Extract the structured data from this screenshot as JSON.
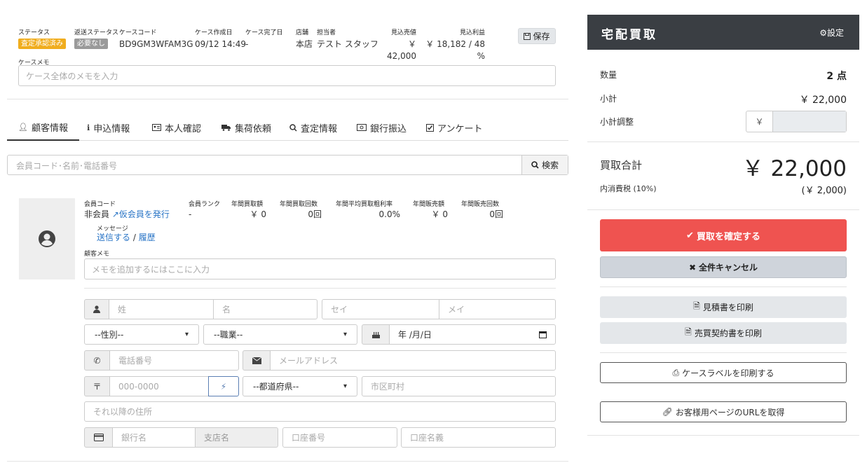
{
  "header": {
    "status_label": "ステータス",
    "status_value": "査定承認済み",
    "return_status_label": "返送ステータス",
    "return_status_value": "必要なし",
    "case_code_label": "ケースコード",
    "case_code_value": "BD9GM3WFAM3G",
    "created_label": "ケース作成日",
    "created_value": "09/12 14:49",
    "completed_label": "ケース完了日",
    "completed_value": "-",
    "store_label": "店舗",
    "store_value": "本店",
    "staff_label": "担当者",
    "staff_value": "テスト スタッフ",
    "expected_sales_label": "見込売値",
    "expected_sales_value": "￥ 42,000",
    "expected_profit_label": "見込利益",
    "expected_profit_value": "￥ 18,182 / 48 %",
    "save_label": "保存",
    "case_memo_label": "ケースメモ",
    "case_memo_placeholder": "ケース全体のメモを入力"
  },
  "tabs": [
    {
      "label": "顧客情報",
      "icon": "user-icon"
    },
    {
      "label": "申込情報",
      "icon": "info-icon"
    },
    {
      "label": "本人確認",
      "icon": "id-card-icon"
    },
    {
      "label": "集荷依頼",
      "icon": "truck-icon"
    },
    {
      "label": "査定情報",
      "icon": "search-icon"
    },
    {
      "label": "銀行振込",
      "icon": "money-icon"
    },
    {
      "label": "アンケート",
      "icon": "check-square-icon"
    }
  ],
  "search": {
    "placeholder": "会員コード･名前･電話番号",
    "button_label": "検索"
  },
  "customer": {
    "member_code_label": "会員コード",
    "member_code_value": "非会員",
    "temp_member_link": "仮会員を発行",
    "rank_label": "会員ランク",
    "rank_value": "-",
    "annual_purchase_label": "年間買取額",
    "annual_purchase_value": "￥ 0",
    "annual_purchase_count_label": "年間買取回数",
    "annual_purchase_count_value": "0回",
    "avg_margin_label": "年間平均買取粗利率",
    "avg_margin_value": "0.0%",
    "annual_sales_label": "年間販売額",
    "annual_sales_value": "￥ 0",
    "annual_sales_count_label": "年間販売回数",
    "annual_sales_count_value": "0回",
    "message_label": "メッセージ",
    "send_link": "送信する",
    "separator": "/",
    "history_link": "履歴",
    "memo_label": "顧客メモ",
    "memo_placeholder": "メモを追加するにはここに入力"
  },
  "form": {
    "last_name": "姓",
    "first_name": "名",
    "last_kana": "セイ",
    "first_kana": "メイ",
    "gender": "--性別--",
    "occupation": "--職業--",
    "birthday": "年 /月/日",
    "phone": "電話番号",
    "email": "メールアドレス",
    "postal_symbol": "〒",
    "postal": "000-0000",
    "prefecture": "--都道府県--",
    "city": "市区町村",
    "address": "それ以降の住所",
    "bank": "銀行名",
    "branch": "支店名",
    "account_no": "口座番号",
    "account_name": "口座名義"
  },
  "panel": {
    "title": "宅配買取",
    "settings_label": "設定",
    "qty_label": "数量",
    "qty_value": "2 点",
    "subtotal_label": "小計",
    "subtotal_value": "￥ 22,000",
    "adjust_label": "小計調整",
    "adjust_prefix": "￥",
    "total_label": "買取合計",
    "total_value": "￥ 22,000",
    "tax_label": "内消費税 (10%)",
    "tax_value": "(￥ 2,000)",
    "confirm_label": "買取を確定する",
    "cancel_label": "全件キャンセル",
    "estimate_label": "見積書を印刷",
    "contract_label": "売買契約書を印刷",
    "case_label_print": "ケースラベルを印刷する",
    "customer_url": "お客様用ページのURLを取得"
  },
  "colors": {
    "danger": "#ef5350",
    "dark": "#3a3e43",
    "link": "#2a75c6",
    "warning": "#f0ad1e"
  }
}
